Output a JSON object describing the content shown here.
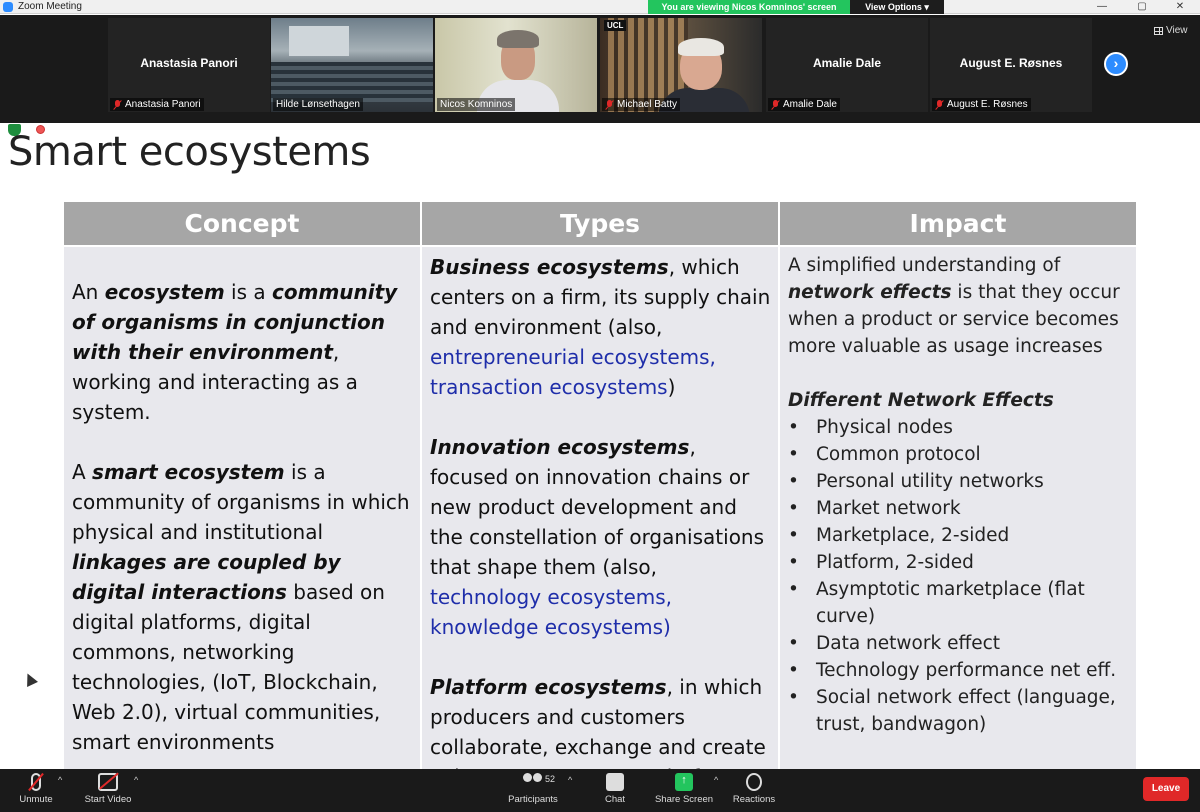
{
  "window": {
    "title": "Zoom Meeting",
    "minimize": "—",
    "maximize": "▢",
    "close": "✕"
  },
  "banner": {
    "viewing": "You are viewing Nicos Komninos' screen",
    "view_options": "View Options ▾"
  },
  "gallery": {
    "participants": [
      {
        "name": "Anastasia Panori",
        "label": "Anastasia Panori",
        "muted": true,
        "video": false
      },
      {
        "name": "Hilde Lønsethagen",
        "label": "Hilde Lønsethagen",
        "muted": false,
        "video": true
      },
      {
        "name": "Nicos Komninos",
        "label": "Nicos Komninos",
        "muted": false,
        "video": true,
        "active": true
      },
      {
        "name": "Michael Batty",
        "label": "Michael Batty",
        "muted": true,
        "video": true
      },
      {
        "name": "Amalie Dale",
        "label": "Amalie Dale",
        "muted": true,
        "video": false
      },
      {
        "name": "August E. Røsnes",
        "label": "August E. Røsnes",
        "muted": true,
        "video": false
      }
    ],
    "next_icon": "›",
    "view_label": "View",
    "ucl_logo": "UCL"
  },
  "slide": {
    "title": "Smart ecosystems",
    "headers": [
      "Concept",
      "Types",
      "Impact"
    ],
    "concept": {
      "p1": [
        "An ",
        "ecosystem",
        " is a ",
        "community of organisms in conjunction with their environment",
        ", working and interacting as a system."
      ],
      "p2": [
        "A ",
        "smart ecosystem",
        " is a community of organisms in which physical and institutional ",
        "linkages are coupled by digital interactions",
        " based on digital platforms, digital commons, networking technologies, (IoT, Blockchain, Web 2.0), virtual communities, smart environments"
      ]
    },
    "types": {
      "business_title": "Business ecosystems",
      "business_text": ", which centers on a firm, its supply chain and environment (also,",
      "business_links": "entrepreneurial ecosystems, transaction ecosystems",
      "business_close": ")",
      "innovation_title": "Innovation ecosystems",
      "innovation_text": ", focused on innovation chains or new product development and the constellation of organisations that shape them (also,",
      "innovation_links": "technology ecosystems, knowledge ecosystems)",
      "platform_title": "Platform ecosystems",
      "platform_text": ", in which producers and customers collaborate, exchange and create value over a common platform"
    },
    "impact": {
      "intro_a": "A simplified understanding of ",
      "intro_b": "network effects",
      "intro_c": " is that they occur when a product or service becomes more valuable as usage increases",
      "list_title": "Different Network Effects",
      "items": [
        "Physical nodes",
        "Common protocol",
        "Personal utility networks",
        "Market network",
        "Marketplace, 2-sided",
        "Platform, 2-sided",
        "Asymptotic marketplace (flat curve)",
        "Data network effect",
        "Technology performance net eff.",
        "Social network effect (language, trust, bandwagon)"
      ]
    }
  },
  "toolbar": {
    "unmute": "Unmute",
    "start_video": "Start Video",
    "participants": "Participants",
    "participants_count": "52",
    "chat": "Chat",
    "share_screen": "Share Screen",
    "reactions": "Reactions",
    "leave": "Leave",
    "caret": "^",
    "share_arrow": "↑"
  }
}
